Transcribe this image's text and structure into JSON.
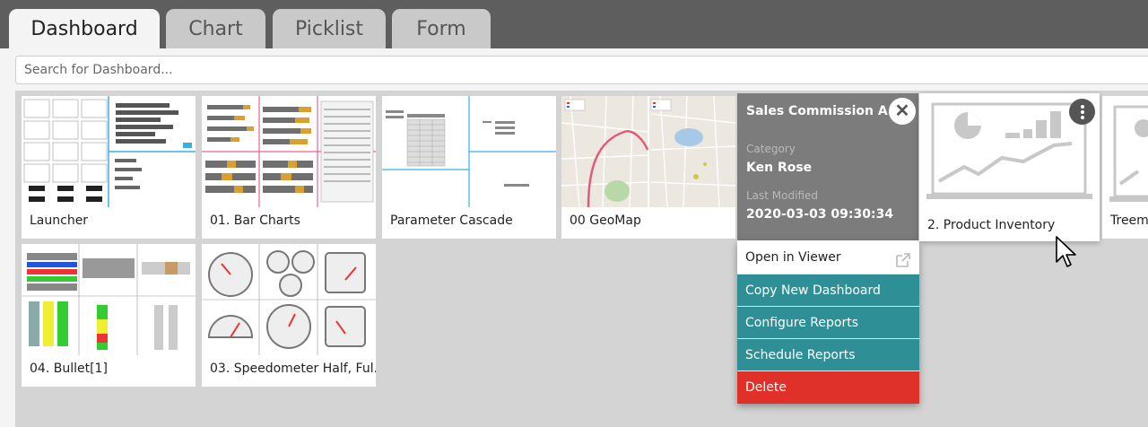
{
  "tabs": [
    {
      "label": "Dashboard",
      "active": true
    },
    {
      "label": "Chart",
      "active": false
    },
    {
      "label": "Picklist",
      "active": false
    },
    {
      "label": "Form",
      "active": false
    }
  ],
  "search": {
    "placeholder": "Search for Dashboard..."
  },
  "cards": [
    {
      "label": "Launcher"
    },
    {
      "label": "01. Bar Charts"
    },
    {
      "label": "Parameter Cascade"
    },
    {
      "label": "00 GeoMap"
    },
    {
      "label": "2. Product Inventory"
    },
    {
      "label": "Treema"
    },
    {
      "label": "04. Bullet[1]"
    },
    {
      "label": "03. Speedometer Half, Ful..."
    }
  ],
  "info": {
    "title": "Sales Commission A...",
    "category_label": "Category",
    "category_value": "Ken Rose",
    "modified_label": "Last Modified",
    "modified_value": "2020-03-03 09:30:34"
  },
  "menu": {
    "open": "Open in Viewer",
    "copy": "Copy New Dashboard",
    "configure": "Configure Reports",
    "schedule": "Schedule Reports",
    "delete": "Delete"
  },
  "colors": {
    "teal": "#2f8f96",
    "red": "#e0302a",
    "tab_bg": "#5e5e5e"
  }
}
